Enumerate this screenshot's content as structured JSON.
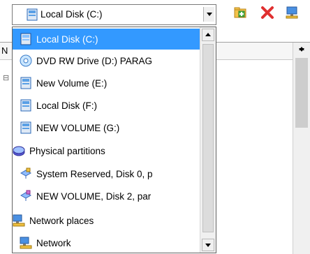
{
  "combo": {
    "selected_label": "Local Disk (C:)",
    "icon": "hard-disk-icon"
  },
  "toolbar": [
    {
      "icon": "new-folder-icon"
    },
    {
      "icon": "delete-icon"
    },
    {
      "icon": "network-drive-icon"
    }
  ],
  "background": {
    "header_text": "N"
  },
  "dropdown": {
    "items": [
      {
        "label": "Local Disk (C:)",
        "icon": "hard-disk-icon",
        "selected": true
      },
      {
        "label": "DVD RW Drive (D:) PARAG",
        "icon": "dvd-drive-icon"
      },
      {
        "label": "New Volume (E:)",
        "icon": "hard-disk-icon"
      },
      {
        "label": "Local Disk (F:)",
        "icon": "hard-disk-icon"
      },
      {
        "label": "NEW VOLUME (G:)",
        "icon": "hard-disk-icon"
      },
      {
        "label": "Physical partitions",
        "icon": "physical-partitions-icon"
      },
      {
        "label": "System Reserved, Disk 0, p",
        "icon": "partition-icon"
      },
      {
        "label": "NEW VOLUME, Disk 2, par",
        "icon": "partition-icon"
      },
      {
        "label": "Network places",
        "icon": "network-places-icon"
      },
      {
        "label": "Network",
        "icon": "network-icon"
      }
    ]
  },
  "colors": {
    "selection": "#3399ff",
    "border": "#646464"
  }
}
